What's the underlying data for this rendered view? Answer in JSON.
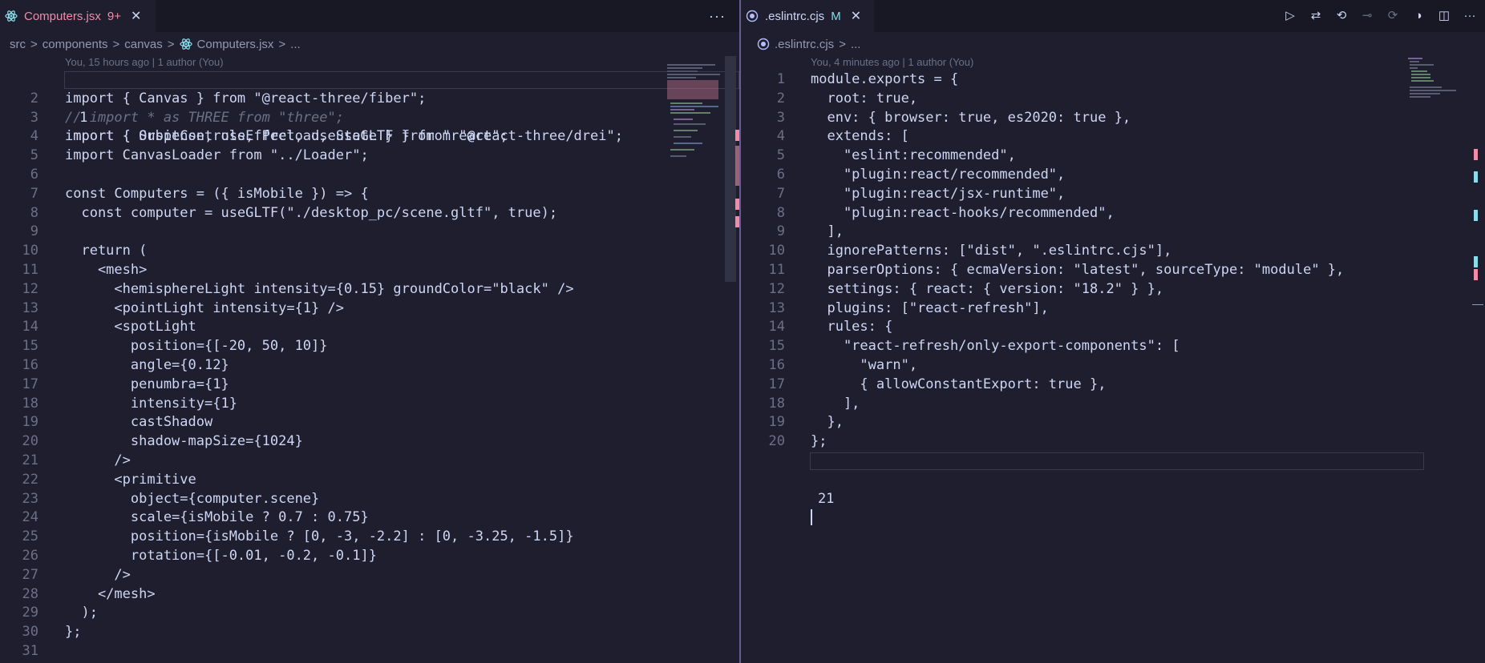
{
  "left": {
    "tab": {
      "title": "Computers.jsx",
      "status": "9+",
      "icon": "react-icon"
    },
    "more": "···",
    "breadcrumb": [
      "src",
      "components",
      "canvas",
      "Computers.jsx",
      "..."
    ],
    "blame": "You, 15 hours ago | 1 author (You)",
    "lines": [
      "import { Suspense, useEffect, useState } from \"react\";",
      "import { Canvas } from \"@react-three/fiber\";",
      "// import * as THREE from \"three\";",
      "import { OrbitControls, Preload, useGLTF } from \"@react-three/drei\";",
      "import CanvasLoader from \"../Loader\";",
      "",
      "const Computers = ({ isMobile }) => {",
      "  const computer = useGLTF(\"./desktop_pc/scene.gltf\", true);",
      "",
      "  return (",
      "    <mesh>",
      "      <hemisphereLight intensity={0.15} groundColor=\"black\" />",
      "      <pointLight intensity={1} />",
      "      <spotLight",
      "        position={[-20, 50, 10]}",
      "        angle={0.12}",
      "        penumbra={1}",
      "        intensity={1}",
      "        castShadow",
      "        shadow-mapSize={1024}",
      "      />",
      "      <primitive",
      "        object={computer.scene}",
      "        scale={isMobile ? 0.7 : 0.75}",
      "        position={isMobile ? [0, -3, -2.2] : [0, -3.25, -1.5]}",
      "        rotation={[-0.01, -0.2, -0.1]}",
      "      />",
      "    </mesh>",
      "  );",
      "};",
      ""
    ]
  },
  "right": {
    "tab": {
      "title": ".eslintrc.cjs",
      "status": "M",
      "icon": "eslint-icon"
    },
    "breadcrumb": [
      ".eslintrc.cjs",
      "..."
    ],
    "blame": "You, 4 minutes ago | 1 author (You)",
    "lines": [
      "module.exports = {",
      "  root: true,",
      "  env: { browser: true, es2020: true },",
      "  extends: [",
      "    \"eslint:recommended\",",
      "    \"plugin:react/recommended\",",
      "    \"plugin:react/jsx-runtime\",",
      "    \"plugin:react-hooks/recommended\",",
      "  ],",
      "  ignorePatterns: [\"dist\", \".eslintrc.cjs\"],",
      "  parserOptions: { ecmaVersion: \"latest\", sourceType: \"module\" },",
      "  settings: { react: { version: \"18.2\" } },",
      "  plugins: [\"react-refresh\"],",
      "  rules: {",
      "    \"react-refresh/only-export-components\": [",
      "      \"warn\",",
      "      { allowConstantExport: true },",
      "    ],",
      "  },",
      "};",
      ""
    ]
  },
  "colors": {
    "background": "#1e1e2e",
    "tab_title_modified": "#f38ba8",
    "tab_status_right": "#89dceb",
    "keyword": "#cba6f7",
    "string": "#a6e3a1"
  }
}
